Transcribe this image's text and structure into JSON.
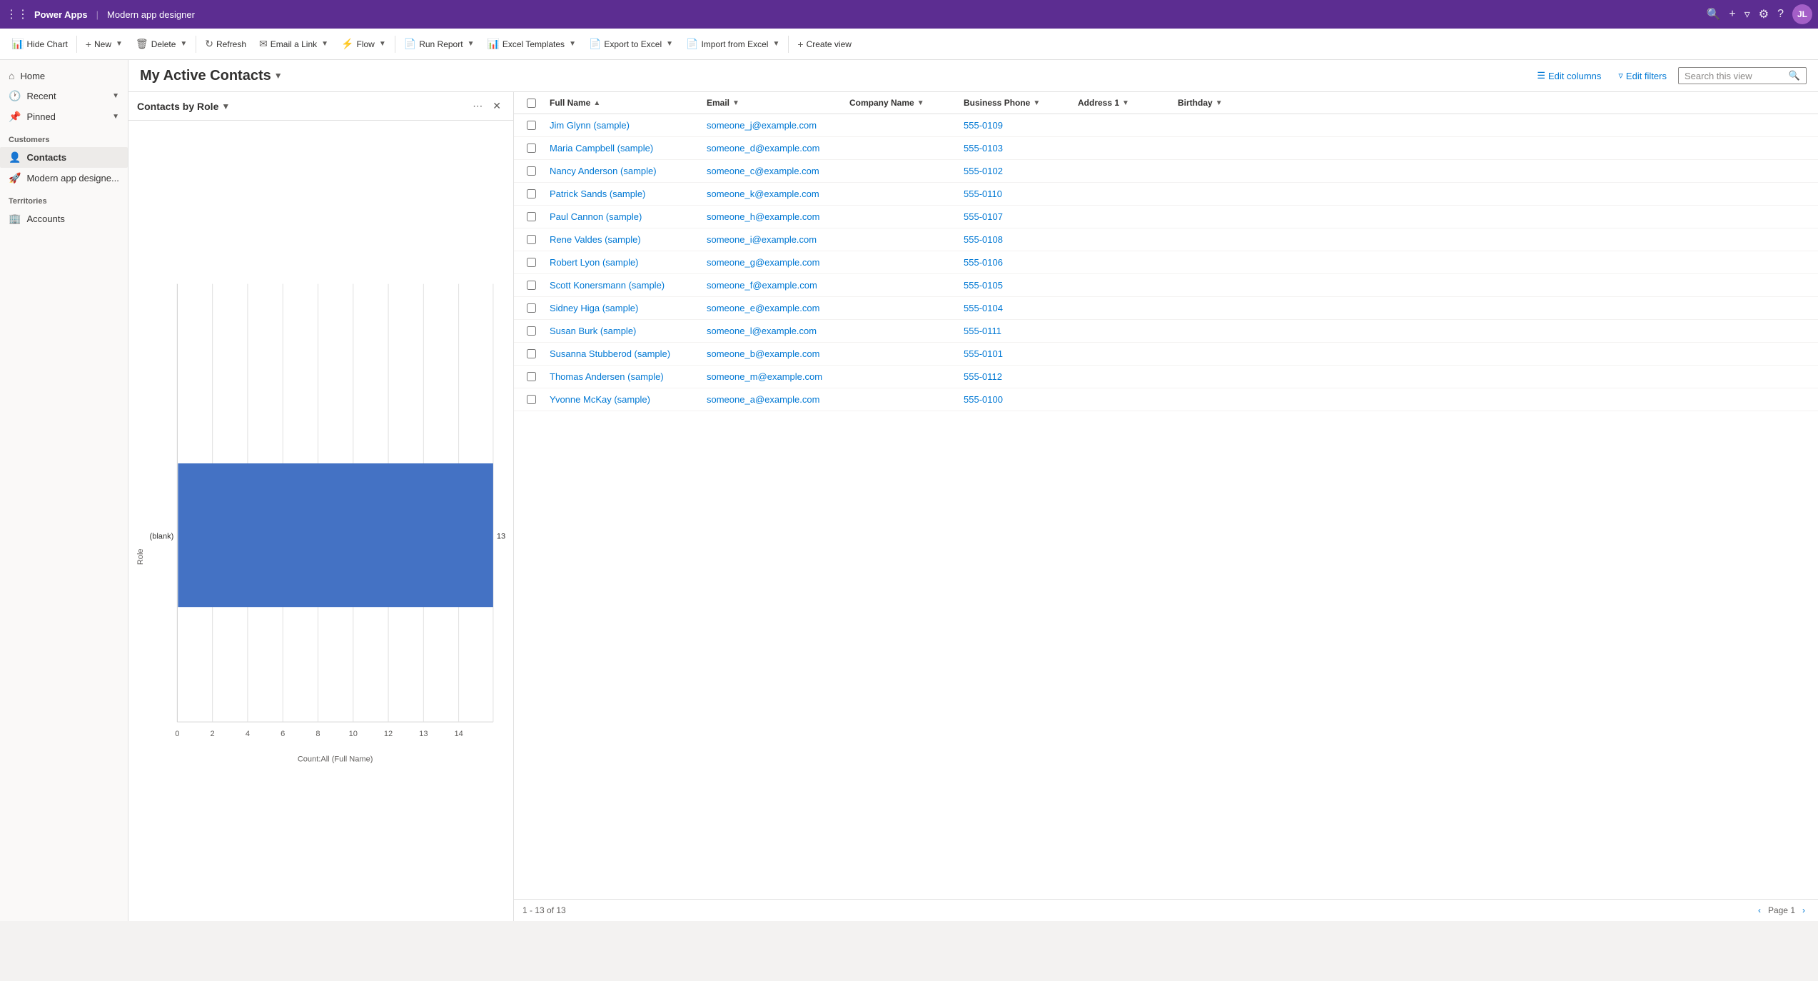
{
  "app": {
    "name": "Power Apps",
    "page": "Modern app designer",
    "avatar_initials": "JL"
  },
  "toolbar": {
    "hide_chart": "Hide Chart",
    "new": "New",
    "delete": "Delete",
    "refresh": "Refresh",
    "email_link": "Email a Link",
    "flow": "Flow",
    "run_report": "Run Report",
    "excel_templates": "Excel Templates",
    "export_to_excel": "Export to Excel",
    "import_from_excel": "Import from Excel",
    "create_view": "Create view"
  },
  "view": {
    "title": "My Active Contacts",
    "edit_columns": "Edit columns",
    "edit_filters": "Edit filters",
    "search_placeholder": "Search this view"
  },
  "chart": {
    "title": "Contacts by Role",
    "bar_label": "(blank)",
    "x_axis_label": "Count:All (Full Name)",
    "y_axis_label": "Role",
    "bar_value": 13,
    "bar_color": "#4472c4",
    "x_ticks": [
      "0",
      "2",
      "4",
      "6",
      "8",
      "10",
      "12",
      "14"
    ]
  },
  "table": {
    "columns": [
      {
        "id": "full_name",
        "label": "Full Name",
        "sortable": true,
        "sort_dir": "asc"
      },
      {
        "id": "email",
        "label": "Email",
        "sortable": true
      },
      {
        "id": "company_name",
        "label": "Company Name",
        "sortable": true
      },
      {
        "id": "business_phone",
        "label": "Business Phone",
        "sortable": true
      },
      {
        "id": "address1",
        "label": "Address 1",
        "sortable": true
      },
      {
        "id": "birthday",
        "label": "Birthday",
        "sortable": true
      }
    ],
    "rows": [
      {
        "full_name": "Jim Glynn (sample)",
        "email": "someone_j@example.com",
        "company": "",
        "phone": "555-0109",
        "address": "",
        "birthday": ""
      },
      {
        "full_name": "Maria Campbell (sample)",
        "email": "someone_d@example.com",
        "company": "",
        "phone": "555-0103",
        "address": "",
        "birthday": ""
      },
      {
        "full_name": "Nancy Anderson (sample)",
        "email": "someone_c@example.com",
        "company": "",
        "phone": "555-0102",
        "address": "",
        "birthday": ""
      },
      {
        "full_name": "Patrick Sands (sample)",
        "email": "someone_k@example.com",
        "company": "",
        "phone": "555-0110",
        "address": "",
        "birthday": ""
      },
      {
        "full_name": "Paul Cannon (sample)",
        "email": "someone_h@example.com",
        "company": "",
        "phone": "555-0107",
        "address": "",
        "birthday": ""
      },
      {
        "full_name": "Rene Valdes (sample)",
        "email": "someone_i@example.com",
        "company": "",
        "phone": "555-0108",
        "address": "",
        "birthday": ""
      },
      {
        "full_name": "Robert Lyon (sample)",
        "email": "someone_g@example.com",
        "company": "",
        "phone": "555-0106",
        "address": "",
        "birthday": ""
      },
      {
        "full_name": "Scott Konersmann (sample)",
        "email": "someone_f@example.com",
        "company": "",
        "phone": "555-0105",
        "address": "",
        "birthday": ""
      },
      {
        "full_name": "Sidney Higa (sample)",
        "email": "someone_e@example.com",
        "company": "",
        "phone": "555-0104",
        "address": "",
        "birthday": ""
      },
      {
        "full_name": "Susan Burk (sample)",
        "email": "someone_l@example.com",
        "company": "",
        "phone": "555-0111",
        "address": "",
        "birthday": ""
      },
      {
        "full_name": "Susanna Stubberod (sample)",
        "email": "someone_b@example.com",
        "company": "",
        "phone": "555-0101",
        "address": "",
        "birthday": ""
      },
      {
        "full_name": "Thomas Andersen (sample)",
        "email": "someone_m@example.com",
        "company": "",
        "phone": "555-0112",
        "address": "",
        "birthday": ""
      },
      {
        "full_name": "Yvonne McKay (sample)",
        "email": "someone_a@example.com",
        "company": "",
        "phone": "555-0100",
        "address": "",
        "birthday": ""
      }
    ],
    "footer": {
      "record_info": "1 - 13 of 13",
      "page_label": "Page 1"
    }
  },
  "sidebar": {
    "items_home": "Home",
    "items_recent": "Recent",
    "items_pinned": "Pinned",
    "section_customers": "Customers",
    "item_contacts": "Contacts",
    "item_modern_designer": "Modern app designe...",
    "section_territories": "Territories",
    "item_accounts": "Accounts"
  }
}
